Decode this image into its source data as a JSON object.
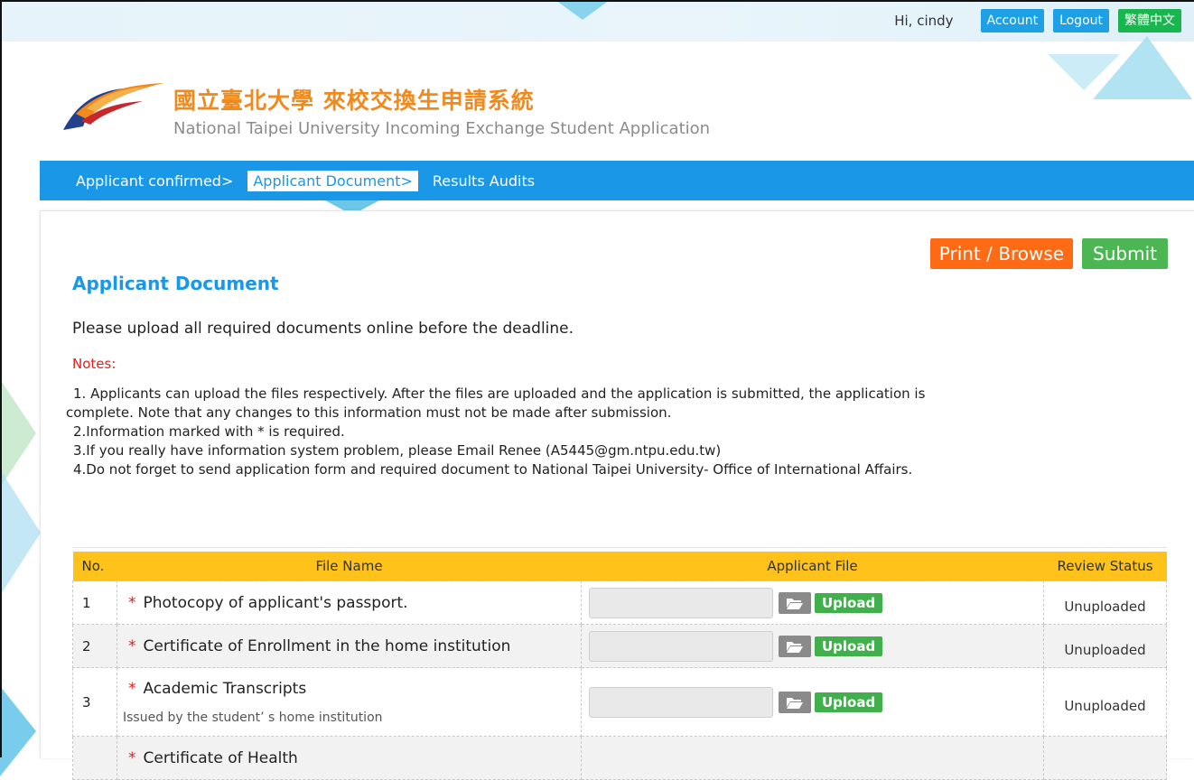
{
  "topbar": {
    "greeting": "Hi, cindy",
    "account": "Account",
    "logout": "Logout",
    "language": "繁體中文"
  },
  "brand": {
    "title_zh": "國立臺北大學 來校交換生申請系統",
    "title_en": "National Taipei University Incoming Exchange Student Application"
  },
  "nav": {
    "items": [
      "Applicant confirmed>",
      "Applicant Document>",
      "Results Audits"
    ],
    "active_index": 1
  },
  "page": {
    "print_label": "Print / Browse",
    "submit_label": "Submit",
    "heading": "Applicant Document",
    "intro": "Please upload all required documents online before the deadline.",
    "notes_title": "Notes:",
    "notes": [
      "1. Applicants can upload the files respectively. After the files are uploaded and the application is submitted, the application is",
      "complete. Note that any changes to this information must not be made after submission.",
      "2.Information marked with * is required.",
      "3.If you really have information system problem, please Email Renee (A5445@gm.ntpu.edu.tw)",
      "4.Do not forget to send application form and required document to National Taipei University- Office of International Affairs."
    ]
  },
  "table": {
    "headers": {
      "no": "No.",
      "file_name": "File Name",
      "applicant_file": "Applicant File",
      "review_status": "Review Status"
    },
    "upload_label": "Upload",
    "required_mark": "*",
    "rows": [
      {
        "no": "1",
        "name": "Photocopy of applicant's passport.",
        "note": "",
        "status": "Unuploaded"
      },
      {
        "no": "2",
        "name": "Certificate of Enrollment in the home institution",
        "note": "",
        "status": "Unuploaded"
      },
      {
        "no": "3",
        "name": "Academic Transcripts",
        "note": "Issued by the student’ s home institution",
        "status": "Unuploaded"
      },
      {
        "no": "",
        "name": "Certificate of Health",
        "note": "",
        "status": ""
      }
    ]
  },
  "colors": {
    "nav_blue": "#1b97e7",
    "orange": "#ff6a14",
    "green": "#4cb752",
    "header_yellow": "#ffc21a",
    "brand_orange": "#f08a1c"
  },
  "icons": [
    "logo-swoosh-icon",
    "folder-open-icon"
  ]
}
